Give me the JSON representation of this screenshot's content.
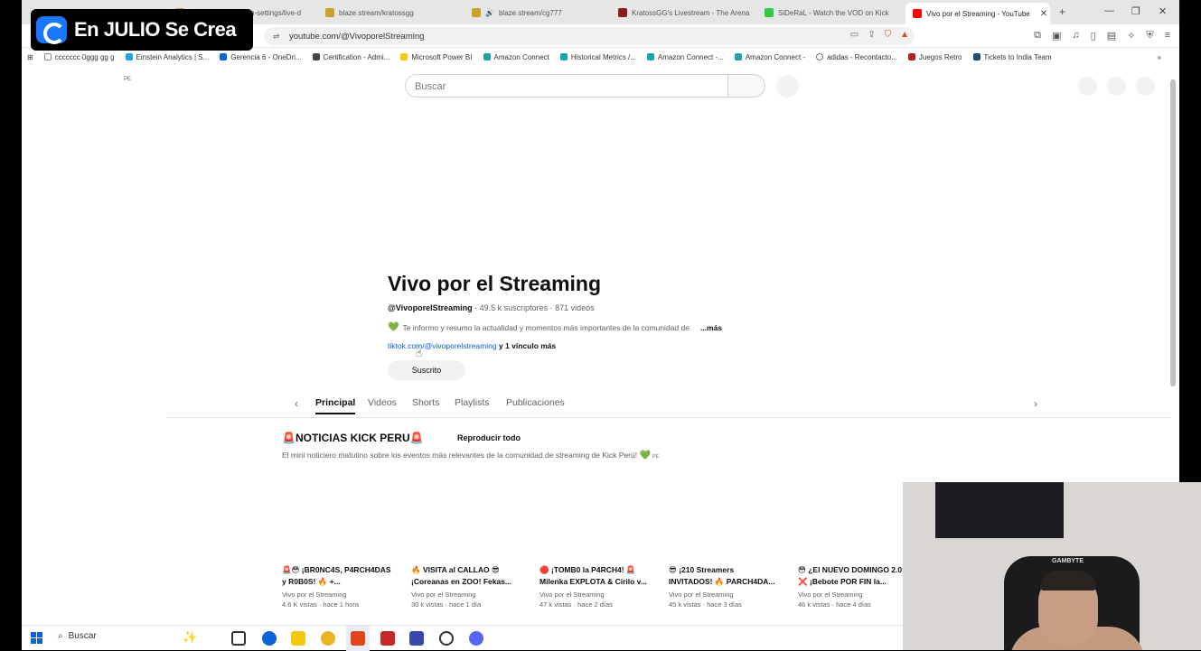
{
  "overlay": {
    "badge_text": "En JULIO Se Crea",
    "badge_icon": "onlyfans-logo-icon"
  },
  "browser": {
    "tabs": [
      {
        "label": "blaze.stream/stream-settings/live-d",
        "color": "#c9a227"
      },
      {
        "label": "blaze.stream/kratossgg",
        "color": "#c9a227"
      },
      {
        "label": "blaze.stream/cg777",
        "color": "#c9a227"
      },
      {
        "label": "KratossGG's Livestream - The Arena",
        "color": "#8a1c1c"
      },
      {
        "label": "SiDeRaL - Watch the VOD on Kick",
        "color": "#2ecc40"
      },
      {
        "label": "Vivo por el Streaming - YouTube",
        "color": "#ff0000"
      }
    ],
    "url": "youtube.com/@VivoporelStreaming",
    "bookmarks": [
      {
        "label": "ccccccc 0ggg gg g",
        "color": "#888888"
      },
      {
        "label": "Einstein Analytics | S...",
        "color": "#1ea5e6"
      },
      {
        "label": "Gerencia 6 - OneDri...",
        "color": "#0a64d6"
      },
      {
        "label": "Certification - Admi...",
        "color": "#444444"
      },
      {
        "label": "Microsoft Power BI",
        "color": "#f2c811"
      },
      {
        "label": "Amazon Connect",
        "color": "#1fa3a3"
      },
      {
        "label": "Historical Metrics /...",
        "color": "#1fa3a3"
      },
      {
        "label": "Amazon Connect -...",
        "color": "#1fa3a3"
      },
      {
        "label": "Amazon Connect -",
        "color": "#1fa3a3"
      },
      {
        "label": "adidas - Recontacto...",
        "color": "#777777"
      },
      {
        "label": "Juegos Retro",
        "color": "#b22222"
      },
      {
        "label": "Tickets to India Team",
        "color": "#1f4e79"
      }
    ]
  },
  "youtube": {
    "country": "PE",
    "search_placeholder": "Buscar",
    "channel": {
      "name": "Vivo por el Streaming",
      "handle": "@VivoporelStreaming",
      "stats": " · 49.5 k suscriptores · 871 videos",
      "description": "Te informo y resumo la actualidad y momentos más importantes de la comunidad de",
      "more": "...más",
      "link": "tiktok.com/@vivoporelstreaming",
      "link_extra": " y 1 vínculo más",
      "subscribe_label": "Suscrito"
    },
    "tabs": [
      "Principal",
      "Videos",
      "Shorts",
      "Playlists",
      "Publicaciones"
    ],
    "section": {
      "title": "🚨NOTICIAS KICK PERU🚨",
      "play_all": "Reproducir todo",
      "description": "El mini noticiero matutino sobre los eventos más relevantes de la comunidad de streaming de Kick Perú!",
      "desc_suffix": "PE"
    },
    "videos": [
      {
        "title": "🚨😳 ¡BR0NC4S, P4RCH4DAS y R0B0S! 🔥 +...",
        "channel": "Vivo por el Streaming",
        "stats": "4.6 K vistas · hace 1 hora"
      },
      {
        "title": "🔥 VISITA al CALLAO 😎 ¡Coreanas en ZOO! Fekas...",
        "channel": "Vivo por el Streaming",
        "stats": "30 k vistas · hace 1 día"
      },
      {
        "title": "🔴 ¡TOMB0 la P4RCH4! 🚨 Milenka EXPLOTA & Cirilo v...",
        "channel": "Vivo por el Streaming",
        "stats": "47 k vistas · hace 2 días"
      },
      {
        "title": "😎 ¡210 Streamers INVITADOS! 🔥 PARCH4DA...",
        "channel": "Vivo por el Streaming",
        "stats": "45 k vistas · hace 3 días"
      },
      {
        "title": "😳 ¿El NUEVO DOMINGO 2.0? ❌ ¡Bebote POR FIN la...",
        "channel": "Vivo por el Streaming",
        "stats": "46 k vistas · hace 4 días"
      }
    ]
  },
  "taskbar": {
    "search_label": "Buscar"
  },
  "webcam": {
    "chair_label": "GAMBYTE"
  }
}
